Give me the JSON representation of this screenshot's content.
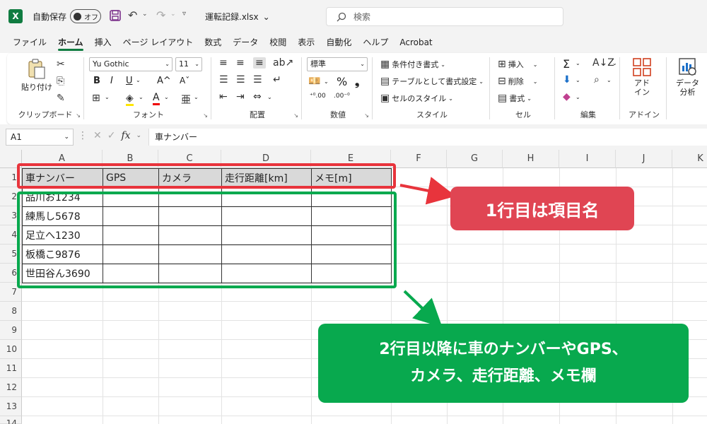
{
  "titlebar": {
    "app_icon": "X",
    "autosave_label": "自動保存",
    "autosave_state": "オフ",
    "filename": "運転記録.xlsx",
    "filename_chevron": "⌄",
    "search_placeholder": "検索"
  },
  "tabs": [
    "ファイル",
    "ホーム",
    "挿入",
    "ページ レイアウト",
    "数式",
    "データ",
    "校閲",
    "表示",
    "自動化",
    "ヘルプ",
    "Acrobat"
  ],
  "active_tab": "ホーム",
  "ribbon": {
    "clipboard": {
      "label": "クリップボード",
      "paste": "貼り付け"
    },
    "font": {
      "label": "フォント",
      "font_name": "Yu Gothic",
      "font_size": "11",
      "bold": "B",
      "italic": "I",
      "underline": "U",
      "grow": "A^",
      "shrink": "Aˇ",
      "font_color": "A"
    },
    "alignment": {
      "label": "配置"
    },
    "number": {
      "label": "数値",
      "format": "標準",
      "percent": "%",
      "comma": "❟"
    },
    "styles": {
      "label": "スタイル",
      "conditional": "条件付き書式",
      "table_format": "テーブルとして書式設定",
      "cell_styles": "セルのスタイル"
    },
    "cells": {
      "label": "セル",
      "insert": "挿入",
      "delete": "削除",
      "format": "書式"
    },
    "editing": {
      "label": "編集",
      "sum": "Σ"
    },
    "addins": {
      "label": "アドイン",
      "button": "アド\nイン"
    },
    "analysis": {
      "button": "データ\n分析"
    }
  },
  "formula_bar": {
    "name_box": "A1",
    "cancel": "✕",
    "enter": "✓",
    "fx": "fx",
    "content": "車ナンバー"
  },
  "columns": [
    "A",
    "B",
    "C",
    "D",
    "E",
    "F",
    "G",
    "H",
    "I",
    "J",
    "K"
  ],
  "rows": [
    "1",
    "2",
    "3",
    "4",
    "5",
    "6",
    "7",
    "8",
    "9",
    "10",
    "11",
    "12",
    "13",
    "14"
  ],
  "table": {
    "headers": [
      "車ナンバー",
      "GPS",
      "カメラ",
      "走行距離[km]",
      "メモ[m]"
    ],
    "rows": [
      [
        "品川お1234",
        "",
        "",
        "",
        ""
      ],
      [
        "練馬し5678",
        "",
        "",
        "",
        ""
      ],
      [
        "足立へ1230",
        "",
        "",
        "",
        ""
      ],
      [
        "板橋こ9876",
        "",
        "",
        "",
        ""
      ],
      [
        "世田谷ん3690",
        "",
        "",
        "",
        ""
      ]
    ]
  },
  "annotations": {
    "red": "1行目は項目名",
    "green_line1": "2行目以降に車のナンバーやGPS、",
    "green_line2": "カメラ、走行距離、メモ欄",
    "colors": {
      "red": "#e8343c",
      "red_fill": "#e04553",
      "green": "#08a94e"
    }
  }
}
